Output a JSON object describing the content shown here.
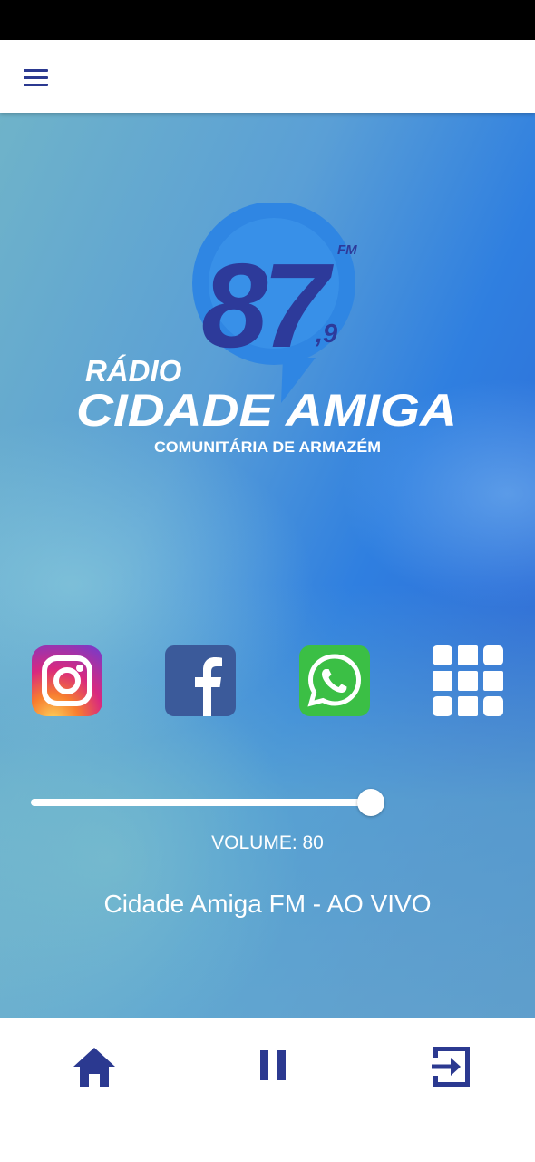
{
  "brand": {
    "frequency_main": "87",
    "frequency_decimal": ",9",
    "band": "FM",
    "line1": "RÁDIO",
    "line2": "CIDADE AMIGA",
    "line3": "COMUNITÁRIA DE ARMAZÉM"
  },
  "social": [
    {
      "name": "instagram",
      "icon": "instagram-icon"
    },
    {
      "name": "facebook",
      "icon": "facebook-icon"
    },
    {
      "name": "whatsapp",
      "icon": "whatsapp-icon"
    },
    {
      "name": "apps",
      "icon": "grid-icon"
    }
  ],
  "player": {
    "volume_label": "VOLUME: 80",
    "volume_value": 80,
    "now_playing": "Cidade Amiga FM - AO VIVO"
  },
  "nav": {
    "home_icon": "home-icon",
    "pause_icon": "pause-icon",
    "exit_icon": "exit-icon"
  },
  "colors": {
    "accent": "#2b3990",
    "logo_blue": "#2d3a9a",
    "logo_circle": "#2f86e3"
  }
}
